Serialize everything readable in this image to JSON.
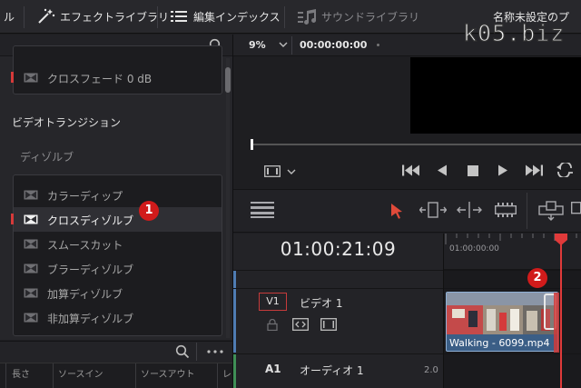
{
  "toolbar": {
    "left_label": "ル",
    "effects_library": "エフェクトライブラリ",
    "edit_index": "編集インデックス",
    "sound_library": "サウンドライブラリ",
    "project_title": "名称未設定のプ"
  },
  "watermark": "k05.biz",
  "effects": {
    "top_items": [
      {
        "label": "クロスフェード 0 dB"
      }
    ],
    "section_title": "ビデオトランジション",
    "category": "ディゾルブ",
    "items": [
      {
        "label": "カラーディップ"
      },
      {
        "label": "クロスディゾルブ"
      },
      {
        "label": "スムースカット"
      },
      {
        "label": "ブラーディゾルブ"
      },
      {
        "label": "加算ディゾルブ"
      },
      {
        "label": "非加算ディゾルブ"
      }
    ]
  },
  "badges": {
    "one": "1",
    "two": "2"
  },
  "media_pool": {
    "columns": [
      "長さ",
      "ソースイン",
      "ソースアウト",
      "レ"
    ]
  },
  "viewer": {
    "zoom": "9%",
    "timecode": "00:00:00:00"
  },
  "timeline": {
    "timecode": "01:00:21:09",
    "ruler_label": "01:00:00:00",
    "video_track": {
      "id": "V1",
      "name": "ビデオ 1"
    },
    "audio_track": {
      "id": "A1",
      "name": "オーディオ 1",
      "level": "2.0"
    },
    "clip": {
      "name": "Walking - 6099.mp4"
    }
  },
  "colors": {
    "accent_red": "#d11b1b",
    "clip_blue": "#3b5e86"
  }
}
